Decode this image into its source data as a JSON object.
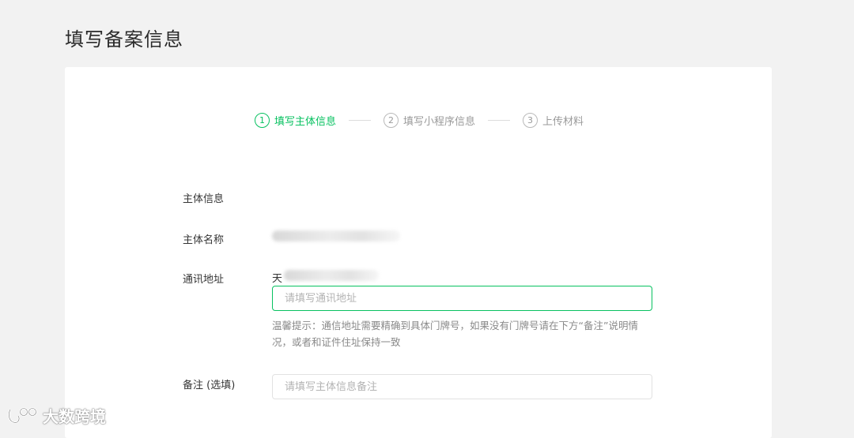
{
  "page": {
    "title": "填写备案信息"
  },
  "steps": [
    {
      "num": "1",
      "label": "填写主体信息",
      "active": true
    },
    {
      "num": "2",
      "label": "填写小程序信息",
      "active": false
    },
    {
      "num": "3",
      "label": "上传材料",
      "active": false
    }
  ],
  "form": {
    "section_title": "主体信息",
    "subject_name": {
      "label": "主体名称"
    },
    "address": {
      "label": "通讯地址",
      "prefix": "天",
      "placeholder": "请填写通讯地址",
      "value": "",
      "hint": "温馨提示：通信地址需要精确到具体门牌号，如果没有门牌号请在下方“备注”说明情况，或者和证件住址保持一致"
    },
    "remark": {
      "label": "备注 (选填)",
      "placeholder": "请填写主体信息备注",
      "value": ""
    }
  },
  "watermark": {
    "text": "大数跨境"
  },
  "colors": {
    "accent": "#07c160",
    "background": "#f2f2f2",
    "card": "#ffffff"
  }
}
